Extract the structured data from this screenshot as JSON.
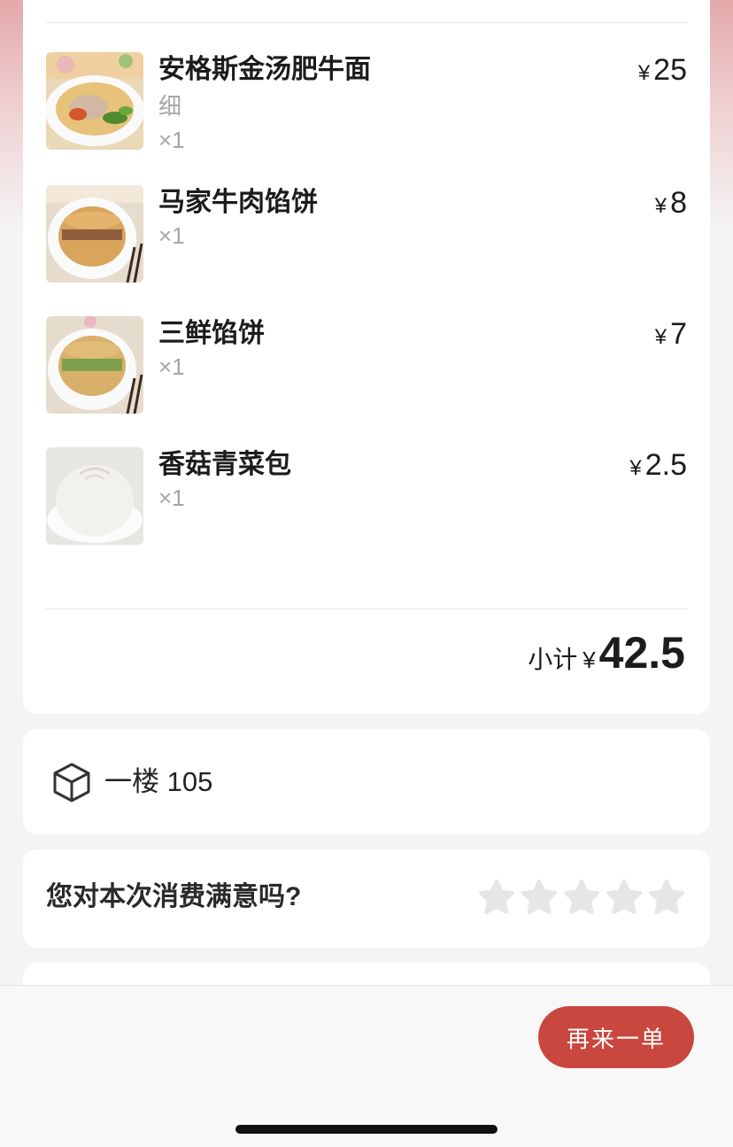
{
  "order": {
    "items": [
      {
        "name": "安格斯金汤肥牛面",
        "spec": "细",
        "qty": "×1",
        "currency": "¥",
        "price": "25",
        "image": "beef-noodle-soup-photo"
      },
      {
        "name": "马家牛肉馅饼",
        "spec": "",
        "qty": "×1",
        "currency": "¥",
        "price": "8",
        "image": "beef-pie-photo"
      },
      {
        "name": "三鲜馅饼",
        "spec": "",
        "qty": "×1",
        "currency": "¥",
        "price": "7",
        "image": "three-delicacy-pie-photo"
      },
      {
        "name": "香菇青菜包",
        "spec": "",
        "qty": "×1",
        "currency": "¥",
        "price": "2.5",
        "image": "mushroom-bun-photo"
      }
    ],
    "subtotal_label": "小计",
    "subtotal_currency": "¥",
    "subtotal_amount": "42.5"
  },
  "location": {
    "icon": "box-icon",
    "text": "一楼 105"
  },
  "rating": {
    "question": "您对本次消费满意吗?",
    "star_count": 5,
    "selected": 0,
    "star_color": "#e6e6e6"
  },
  "footer": {
    "reorder_label": "再来一单",
    "button_color": "#c9473f"
  }
}
